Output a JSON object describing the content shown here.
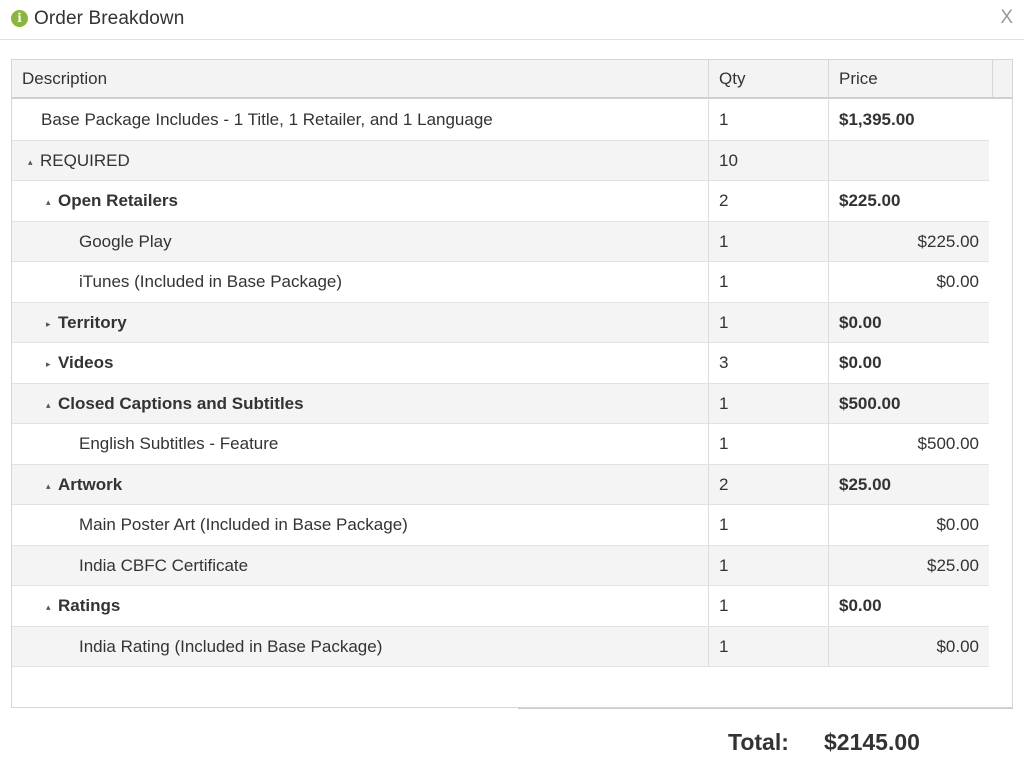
{
  "dialog": {
    "title": "Order Breakdown",
    "close_label": "X",
    "info_glyph": "i"
  },
  "table": {
    "headers": {
      "description": "Description",
      "qty": "Qty",
      "price": "Price"
    },
    "rows": [
      {
        "desc": "Base Package Includes - 1 Title, 1 Retailer, and 1 Language",
        "qty": "1",
        "price": "$1,395.00"
      },
      {
        "desc": "REQUIRED",
        "qty": "10",
        "price": ""
      },
      {
        "desc": "Open Retailers",
        "qty": "2",
        "price": "$225.00"
      },
      {
        "desc": "Google Play",
        "qty": "1",
        "price": "$225.00"
      },
      {
        "desc": "iTunes (Included in Base Package)",
        "qty": "1",
        "price": "$0.00"
      },
      {
        "desc": "Territory",
        "qty": "1",
        "price": "$0.00"
      },
      {
        "desc": "Videos",
        "qty": "3",
        "price": "$0.00"
      },
      {
        "desc": "Closed Captions and Subtitles",
        "qty": "1",
        "price": "$500.00"
      },
      {
        "desc": "English Subtitles - Feature",
        "qty": "1",
        "price": "$500.00"
      },
      {
        "desc": "Artwork",
        "qty": "2",
        "price": "$25.00"
      },
      {
        "desc": "Main Poster Art (Included in Base Package)",
        "qty": "1",
        "price": "$0.00"
      },
      {
        "desc": "India CBFC Certificate",
        "qty": "1",
        "price": "$25.00"
      },
      {
        "desc": "Ratings",
        "qty": "1",
        "price": "$0.00"
      },
      {
        "desc": "India Rating (Included in Base Package)",
        "qty": "1",
        "price": "$0.00"
      }
    ]
  },
  "totals": {
    "label": "Total:",
    "value": "$2145.00"
  },
  "icons": {
    "expanded": "▴",
    "collapsed": "▸"
  },
  "colors": {
    "info_icon": "#8cb53f",
    "header_bg": "#f3f3f3",
    "alt_row_bg": "#f4f4f4"
  }
}
